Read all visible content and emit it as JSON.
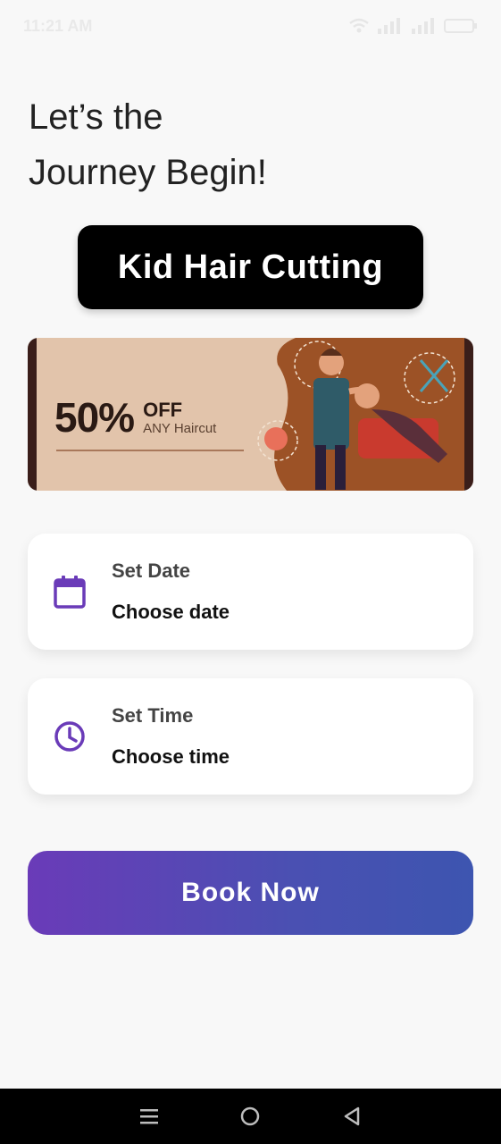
{
  "status_bar": {
    "time": "11:21 AM",
    "icons": [
      "wifi-icon",
      "signal-icon",
      "signal-icon",
      "battery-icon"
    ]
  },
  "headline": {
    "line1": "Let’s the",
    "line2": "Journey Begin!"
  },
  "service": {
    "name": "Kid Hair Cutting"
  },
  "promo": {
    "percent": "50%",
    "off": "OFF",
    "subtitle": "ANY Haircut"
  },
  "date_picker": {
    "label": "Set Date",
    "value": "Choose date",
    "icon": "calendar-icon"
  },
  "time_picker": {
    "label": "Set Time",
    "value": "Choose time",
    "icon": "clock-icon"
  },
  "book_button": {
    "label": "Book Now"
  },
  "nav": {
    "items": [
      "menu-icon",
      "home-icon",
      "back-icon"
    ]
  },
  "colors": {
    "accent": "#6a3bb8",
    "accent_end": "#3d55b0",
    "chip_bg": "#000000",
    "banner_bg": "#e2c4ab"
  }
}
